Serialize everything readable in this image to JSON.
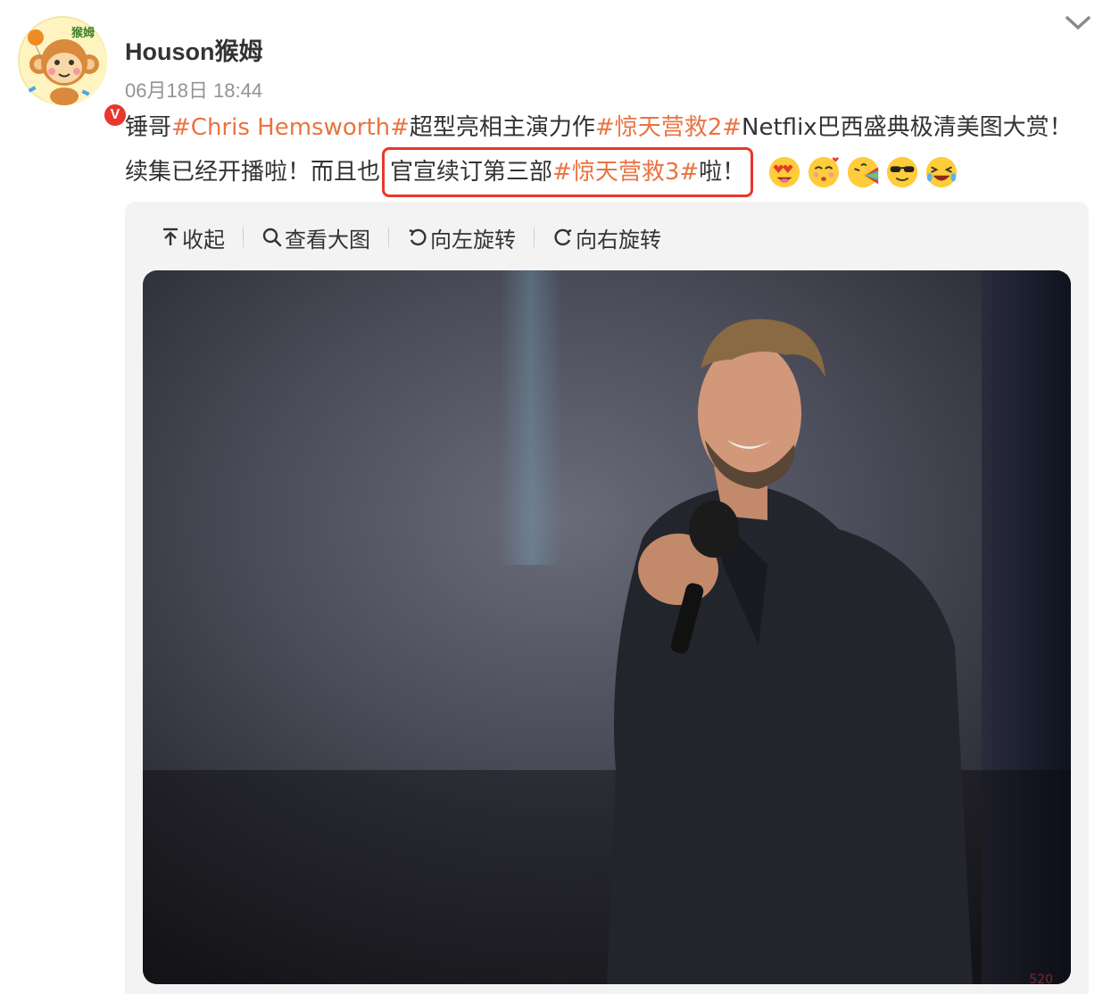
{
  "user": {
    "name": "Houson猴姆",
    "avatar_text": "猴姆",
    "verified_mark": "V"
  },
  "post": {
    "timestamp": "06月18日 18:44",
    "line1": [
      {
        "text": "锤哥",
        "type": "text"
      },
      {
        "text": "#Chris Hemsworth#",
        "type": "topic"
      },
      {
        "text": "超型亮相主演力作",
        "type": "text"
      },
      {
        "text": "#惊天营救2#",
        "type": "topic"
      },
      {
        "text": "Netflix巴西盛典极清美图大赏！",
        "type": "text"
      }
    ],
    "line2_prefix": "续集已经开播啦！而且也",
    "line2_highlight_text": "官宣续订第三部",
    "line2_highlight_topic": "#惊天营救3#",
    "line2_highlight_suffix": "啦！",
    "emojis": [
      "heart-eyes-emoji",
      "kiss-emoji",
      "rainbow-emoji",
      "sunglasses-emoji",
      "laugh-cry-emoji"
    ]
  },
  "toolbar": {
    "collapse_label": "收起",
    "view_large_label": "查看大图",
    "rotate_left_label": "向左旋转",
    "rotate_right_label": "向右旋转"
  },
  "watermark": "520",
  "colors": {
    "topic": "#eb7340",
    "highlight_border": "#e8372b",
    "card_bg": "#f3f3f3"
  }
}
